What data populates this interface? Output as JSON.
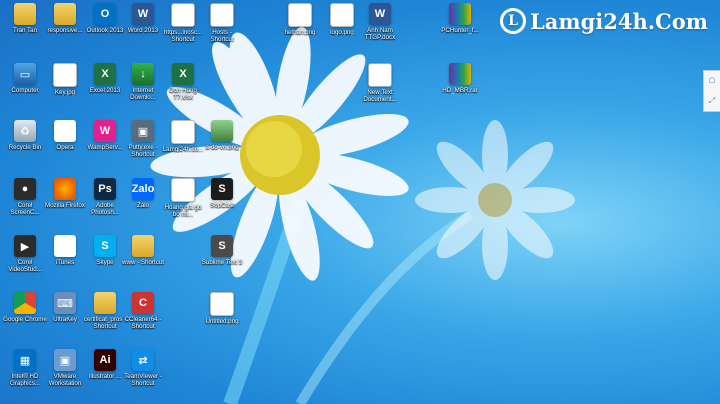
{
  "watermark": {
    "text": "Lamgi24h.Com",
    "logo_letter": "L"
  },
  "desktop": {
    "icons": [
      {
        "label": "Tran Tan",
        "icon": "folder-icon",
        "glyph": "",
        "cls": "g-folder"
      },
      {
        "label": "responsive...",
        "icon": "folder-icon",
        "glyph": "",
        "cls": "g-folder"
      },
      {
        "label": "Outlook 2013",
        "icon": "outlook-icon",
        "glyph": "O",
        "cls": "g-outlook"
      },
      {
        "label": "Word 2013",
        "icon": "word-icon",
        "glyph": "W",
        "cls": "g-word"
      },
      {
        "label": "https...inosc... Shortcut",
        "icon": "shortcut-icon",
        "glyph": "",
        "cls": "g-doc"
      },
      {
        "label": "Hosts - Shortcut",
        "icon": "shortcut-icon",
        "glyph": "",
        "cls": "g-doc"
      },
      {
        "label": "hethan.png",
        "icon": "image-file-icon",
        "glyph": "",
        "cls": "g-png"
      },
      {
        "label": "logo.png",
        "icon": "image-file-icon",
        "glyph": "",
        "cls": "g-png"
      },
      {
        "label": "Anh Nam TTGP.docx",
        "icon": "word-doc-icon",
        "glyph": "W",
        "cls": "g-word"
      },
      {
        "label": "PCHunter_f...",
        "icon": "winrar-icon",
        "glyph": "",
        "cls": "g-winrar"
      },
      {
        "label": "Computer",
        "icon": "computer-icon",
        "glyph": "▭",
        "cls": "g-pc"
      },
      {
        "label": "Key.jpg",
        "icon": "image-file-icon",
        "glyph": "",
        "cls": "g-png"
      },
      {
        "label": "Excel 2013",
        "icon": "excel-icon",
        "glyph": "X",
        "cls": "g-excel"
      },
      {
        "label": "Internet Downlo...",
        "icon": "idm-icon",
        "glyph": "↓",
        "cls": "g-idm"
      },
      {
        "label": "Don Hang T7.xlsx",
        "icon": "excel-file-icon",
        "glyph": "X",
        "cls": "g-excel"
      },
      {
        "label": "New Text Document...",
        "icon": "text-file-icon",
        "glyph": "",
        "cls": "g-doc"
      },
      {
        "label": "HD_MBR.rar",
        "icon": "winrar-icon",
        "glyph": "",
        "cls": "g-winrar"
      },
      {
        "label": "Recycle Bin",
        "icon": "recycle-bin-icon",
        "glyph": "♻",
        "cls": "g-bin"
      },
      {
        "label": "Opera",
        "icon": "opera-icon",
        "glyph": "O",
        "cls": "g-opera"
      },
      {
        "label": "WampServ...",
        "icon": "wamp-icon",
        "glyph": "W",
        "cls": "g-wamp"
      },
      {
        "label": "Putty.exe - Shortcut",
        "icon": "putty-icon",
        "glyph": "▣",
        "cls": "g-putty"
      },
      {
        "label": "Lamgi24h.co...",
        "icon": "image-file-icon",
        "glyph": "",
        "cls": "g-png"
      },
      {
        "label": "a-do-vn.png",
        "icon": "photo-icon",
        "glyph": "",
        "cls": "g-photo"
      },
      {
        "label": "Corel ScreenC...",
        "icon": "corel-icon",
        "glyph": "●",
        "cls": "g-corel"
      },
      {
        "label": "Mozilla Firefox",
        "icon": "firefox-icon",
        "glyph": "",
        "cls": "g-firefox"
      },
      {
        "label": "Adobe Photosh...",
        "icon": "photoshop-icon",
        "glyph": "Ps",
        "cls": "g-ps"
      },
      {
        "label": "Zalo",
        "icon": "zalo-icon",
        "glyph": "Zalo",
        "cls": "g-zalo"
      },
      {
        "label": "Hoang gia go bo mi...",
        "icon": "image-file-icon",
        "glyph": "",
        "cls": "g-png"
      },
      {
        "label": "SopCast",
        "icon": "sopcast-icon",
        "glyph": "S",
        "cls": "g-sop"
      },
      {
        "label": "Corel VideoStud...",
        "icon": "corel-video-icon",
        "glyph": "▶",
        "cls": "g-corel"
      },
      {
        "label": "iTunes",
        "icon": "itunes-icon",
        "glyph": "♫",
        "cls": "g-itunes"
      },
      {
        "label": "Skype",
        "icon": "skype-icon",
        "glyph": "S",
        "cls": "g-skype"
      },
      {
        "label": "www - Shortcut",
        "icon": "folder-icon",
        "glyph": "",
        "cls": "g-folder"
      },
      {
        "label": "Sublime Text 3",
        "icon": "sublime-icon",
        "glyph": "S",
        "cls": "g-sublime"
      },
      {
        "label": "Google Chrome",
        "icon": "chrome-icon",
        "glyph": "",
        "cls": "g-chrome"
      },
      {
        "label": "UltraKey",
        "icon": "ultrakey-icon",
        "glyph": "⌨",
        "cls": "g-ultra"
      },
      {
        "label": "certificat_pros - Shortcut",
        "icon": "folder-icon",
        "glyph": "",
        "cls": "g-folder"
      },
      {
        "label": "CCleaner64 - Shortcut",
        "icon": "ccleaner-icon",
        "glyph": "C",
        "cls": "g-cc"
      },
      {
        "label": "Untitled.png",
        "icon": "image-file-icon",
        "glyph": "",
        "cls": "g-png"
      },
      {
        "label": "Intel® HD Graphics...",
        "icon": "intel-graphics-icon",
        "glyph": "▦",
        "cls": "g-intel"
      },
      {
        "label": "VMware Workstation",
        "icon": "vmware-icon",
        "glyph": "▣",
        "cls": "g-vmware"
      },
      {
        "label": "Illustrator ...",
        "icon": "illustrator-icon",
        "glyph": "Ai",
        "cls": "g-ai"
      },
      {
        "label": "TeamViewer - Shortcut",
        "icon": "teamviewer-icon",
        "glyph": "⇄",
        "cls": "g-teamviewer"
      }
    ]
  },
  "side_widget": {
    "items": [
      "☖",
      "⤢"
    ]
  }
}
